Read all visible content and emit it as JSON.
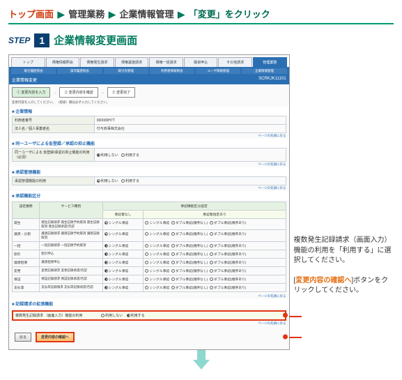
{
  "breadcrumb": {
    "top": "トップ画面",
    "mid1": "管理業務",
    "mid2": "企業情報管理",
    "end": "「変更」をクリック"
  },
  "step": {
    "label": "STEP",
    "num": "1",
    "title": "企業情報変更画面"
  },
  "tabs": [
    "トップ",
    "債権情報照会",
    "債権発生請求",
    "債権譲渡請求",
    "債権一括請求",
    "融資申込",
    "その他請求",
    "管理業務"
  ],
  "subtabs": [
    "取引履歴照会",
    "操作履歴照会",
    "取引先管理",
    "利用者情報照会",
    "ユーザ情報管理",
    "企業情報管理"
  ],
  "bar": {
    "title": "企業情報変更",
    "id": "SCRKJK11101"
  },
  "stepper": [
    "① 変更内容を入力",
    "② 変更内容を確認",
    "③ 変更完了"
  ],
  "note": "変更内容を入力してください。\n（取扱）欄は必ず入力してください。",
  "sect_company": "企業情報",
  "company_rows": [
    {
      "k": "利用者番号",
      "v": "000000H7T"
    },
    {
      "k": "法人名／個人事業者名",
      "v": "付与商事株式会社"
    }
  ],
  "sect_sameuser": "同一ユーザによる仮登録／承認の抑止機能",
  "sameuser_rows": [
    {
      "k": "同一ユーザによる\n仮登録/承認の抑止機能の利用（必須）",
      "v1": "利用しない",
      "v2": "利用する"
    }
  ],
  "sect_approval": "承認管理機能",
  "approval_rows": [
    {
      "k": "承認管理機能の利用",
      "v1": "利用しない",
      "v2": "利用する"
    }
  ],
  "sect_grid": "承認機能区分",
  "grid_headers": {
    "c1": "設定業務",
    "c2": "サービス種別",
    "c3": "承認機能区分設定",
    "sp1": "承認者なし",
    "sp2": "承認者指定あり"
  },
  "grid_rows": [
    {
      "b": "発生",
      "svc": "発生記録請求\n発生記録予約取消\n発生記録取消\n発生記録承諾/否認",
      "a": "シングル承認",
      "o": [
        "シングル承認",
        "ダブル承認(順序なし)",
        "ダブル承認(順序あり)"
      ]
    },
    {
      "b": "譲渡・分割",
      "svc": "譲渡記録請求\n譲渡記録予約取消\n譲渡記録取消",
      "a": "シングル承認",
      "o": [
        "シングル承認",
        "ダブル承認(順序なし)",
        "ダブル承認(順序あり)"
      ]
    },
    {
      "b": "一括",
      "svc": "一括記録請求\n一括記録予約取消",
      "a": "シングル承認",
      "o": [
        "シングル承認",
        "ダブル承認(順序なし)",
        "ダブル承認(順序あり)"
      ]
    },
    {
      "b": "割引",
      "svc": "割引申込",
      "a": "シングル承認",
      "o": [
        "シングル承認",
        "ダブル承認(順序なし)",
        "ダブル承認(順序あり)"
      ]
    },
    {
      "b": "譲渡担保",
      "svc": "譲渡担保申込",
      "a": "シングル承認",
      "o": [
        "シングル承認",
        "ダブル承認(順序なし)",
        "ダブル承認(順序あり)"
      ]
    },
    {
      "b": "変更",
      "svc": "変更記録請求\n変更記録承諾/否認",
      "a": "シングル承認",
      "o": [
        "シングル承認",
        "ダブル承認(順序なし)",
        "ダブル承認(順序あり)"
      ]
    },
    {
      "b": "保証",
      "svc": "保証記録請求\n保証記録承諾/否認",
      "a": "シングル承認",
      "o": [
        "シングル承認",
        "ダブル承認(順序なし)",
        "ダブル承認(順序あり)"
      ]
    },
    {
      "b": "支払等",
      "svc": "支払等記録請求\n支払等記録承諾/否認",
      "a": "シングル承認",
      "o": [
        "シングル承認",
        "ダブル承認(順序なし)",
        "ダブル承認(順序あり)"
      ]
    }
  ],
  "sect_multi": "記録請求の拡張機能",
  "multi": {
    "k": "複数発生記録請求\n（画面入力）機能の利用",
    "v1": "利用しない",
    "v2": "利用する"
  },
  "btn_back": "戻る",
  "btn_confirm": "変更内容の確認へ",
  "pagetop": "ページの先頭に戻る",
  "callout1_a": "複数発生記録請求（画面入力）機能の利用を「利用する」に選択してください。",
  "callout2_a": "[",
  "callout2_b": "変更内容の確認へ",
  "callout2_c": "]ボタンをクリックしてください。"
}
